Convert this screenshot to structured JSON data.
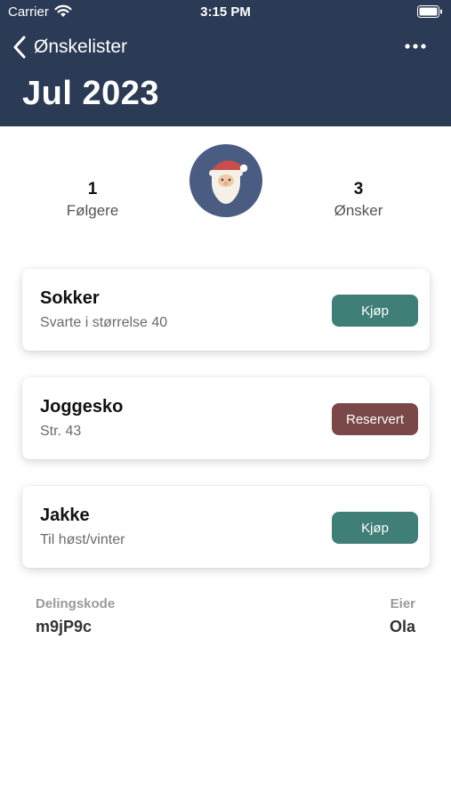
{
  "status_bar": {
    "carrier": "Carrier",
    "time": "3:15 PM"
  },
  "nav": {
    "back_label": "Ønskelister",
    "title": "Jul 2023"
  },
  "stats": {
    "followers": {
      "count": "1",
      "label": "Følgere"
    },
    "wishes": {
      "count": "3",
      "label": "Ønsker"
    }
  },
  "wishes": [
    {
      "title": "Sokker",
      "subtitle": "Svarte i størrelse 40",
      "action": "Kjøp",
      "action_color": "#3f7f78"
    },
    {
      "title": "Joggesko",
      "subtitle": "Str. 43",
      "action": "Reservert",
      "action_color": "#7a4848"
    },
    {
      "title": "Jakke",
      "subtitle": "Til høst/vinter",
      "action": "Kjøp",
      "action_color": "#3f7f78"
    }
  ],
  "share": {
    "code_label": "Delingskode",
    "code": "m9jP9c",
    "owner_label": "Eier",
    "owner": "Ola"
  },
  "colors": {
    "header": "#2b3a55",
    "avatar_bg": "#4a5c82",
    "buy": "#3f7f78",
    "reserved": "#7a4848"
  }
}
